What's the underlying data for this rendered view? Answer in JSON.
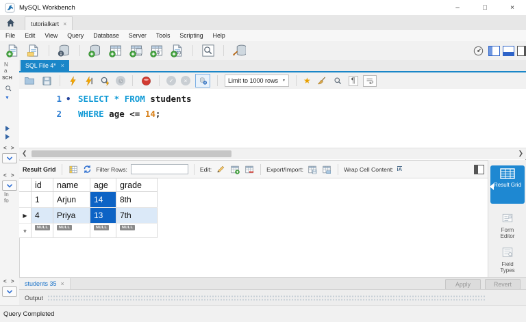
{
  "window": {
    "title": "MySQL Workbench",
    "minimize": "–",
    "maximize": "□",
    "close": "×"
  },
  "workspace": {
    "active_tab": {
      "label": "tutorialkart",
      "close": "×"
    }
  },
  "menu": {
    "items": [
      "File",
      "Edit",
      "View",
      "Query",
      "Database",
      "Server",
      "Tools",
      "Scripting",
      "Help"
    ]
  },
  "main_toolbar": {
    "icon_names": [
      "new-sql-tab",
      "open-sql-script",
      "schema-inspector",
      "create-schema",
      "create-table",
      "create-view",
      "create-procedure",
      "create-function",
      "search-table-data",
      "reconnect-dbms",
      "dashboard",
      "toggle-left-panel",
      "toggle-bottom-panel",
      "toggle-right-panel"
    ]
  },
  "left_rail": {
    "navigator_clip": [
      "N",
      "a"
    ],
    "schemas_clip": "SCH",
    "info_clip": [
      "In",
      "fo"
    ]
  },
  "editor": {
    "tab": {
      "label": "SQL File 4*",
      "close": "×"
    },
    "toolbar": {
      "limit_dropdown": "Limit to 1000 rows",
      "icon_names": [
        "open-file",
        "save",
        "execute",
        "execute-current",
        "explain",
        "stop",
        "toggle-stop-on-error",
        "commit",
        "rollback",
        "toggle-autocommit",
        "add-snippet",
        "beautify",
        "find",
        "invisible-chars",
        "wrap-text"
      ]
    },
    "code": {
      "line1": {
        "num": "1",
        "marker": "•",
        "keyword": "SELECT * FROM",
        "ident": "students"
      },
      "line2": {
        "num": "2",
        "keyword": "WHERE",
        "ident": "age <=",
        "literal": "14",
        "punct": ";"
      }
    }
  },
  "result": {
    "toolbar": {
      "title": "Result Grid",
      "filter_label": "Filter Rows:",
      "filter_value": "",
      "edit_label": "Edit:",
      "export_label": "Export/Import:",
      "wrap_label": "Wrap Cell Content:"
    },
    "table": {
      "columns": [
        "id",
        "name",
        "age",
        "grade"
      ],
      "rows": [
        {
          "marker": "",
          "id": "1",
          "name": "Arjun",
          "age": "14",
          "grade": "8th"
        },
        {
          "marker": "▶",
          "id": "4",
          "name": "Priya",
          "age": "13",
          "grade": "7th"
        }
      ],
      "new_row_marker": "*",
      "null_badge": "NULL"
    },
    "side_tabs": [
      {
        "label": "Result Grid",
        "active": true
      },
      {
        "label": "Form Editor",
        "active": false
      },
      {
        "label": "Field Types",
        "active": false
      }
    ],
    "bottom": {
      "tab_label": "students 35",
      "tab_close": "×",
      "apply": "Apply",
      "revert": "Revert"
    }
  },
  "output": {
    "label": "Output"
  },
  "status_bar": {
    "text": "Query Completed"
  },
  "icons": {
    "caret_down": "▼",
    "pilcrow": "¶",
    "check": "✓",
    "cross": "×",
    "star": "★",
    "wrap_cell": "IA",
    "panel_chevrons": "< >"
  },
  "colors": {
    "accent_blue": "#1a86c8",
    "selection_blue": "#0d63c5",
    "row_highlight_blue": "#dbe9f8",
    "keyword_blue": "#109ad6",
    "literal_orange": "#d8821c",
    "null_badge_gray": "#8a8a8a"
  }
}
